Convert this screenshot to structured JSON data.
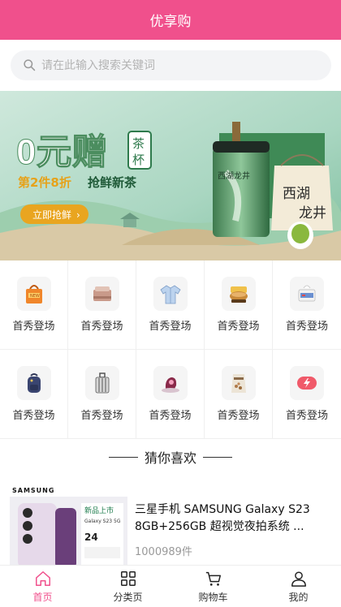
{
  "app": {
    "title": "优享购",
    "accent": "#f0508c"
  },
  "search": {
    "placeholder": "请在此输入搜索关键词"
  },
  "banner": {
    "big_text": "0元赠",
    "seal_text": "茶杯",
    "sub_text": "第2件8折",
    "sub_text2": "抢鲜新茶",
    "cta_label": "立即抢鲜",
    "slides": 3,
    "active_slide": 1
  },
  "categories": [
    {
      "label": "首秀登场",
      "icon": "shopping-bag-icon"
    },
    {
      "label": "首秀登场",
      "icon": "bedding-icon"
    },
    {
      "label": "首秀登场",
      "icon": "shirt-icon"
    },
    {
      "label": "首秀登场",
      "icon": "food-bowl-icon"
    },
    {
      "label": "首秀登场",
      "icon": "tissue-box-icon"
    },
    {
      "label": "首秀登场",
      "icon": "backpack-icon"
    },
    {
      "label": "首秀登场",
      "icon": "suitcase-icon"
    },
    {
      "label": "首秀登场",
      "icon": "vacuum-icon"
    },
    {
      "label": "首秀登场",
      "icon": "snack-bag-icon"
    },
    {
      "label": "首秀登场",
      "icon": "flash-icon"
    }
  ],
  "section": {
    "title": "猜你喜欢"
  },
  "product": {
    "brand": "SAMSUNG",
    "name": "三星手机 SAMSUNG Galaxy S23 8GB+256GB 超视觉夜拍系统 ...",
    "sold": "1000989件",
    "promo_badge": "新品上市",
    "promo_model": "Galaxy S23 5G",
    "promo_price_hint": "24"
  },
  "tabbar": [
    {
      "label": "首页",
      "icon": "home-icon",
      "active": true
    },
    {
      "label": "分类页",
      "icon": "grid-icon",
      "active": false
    },
    {
      "label": "购物车",
      "icon": "cart-icon",
      "active": false
    },
    {
      "label": "我的",
      "icon": "user-icon",
      "active": false
    }
  ]
}
